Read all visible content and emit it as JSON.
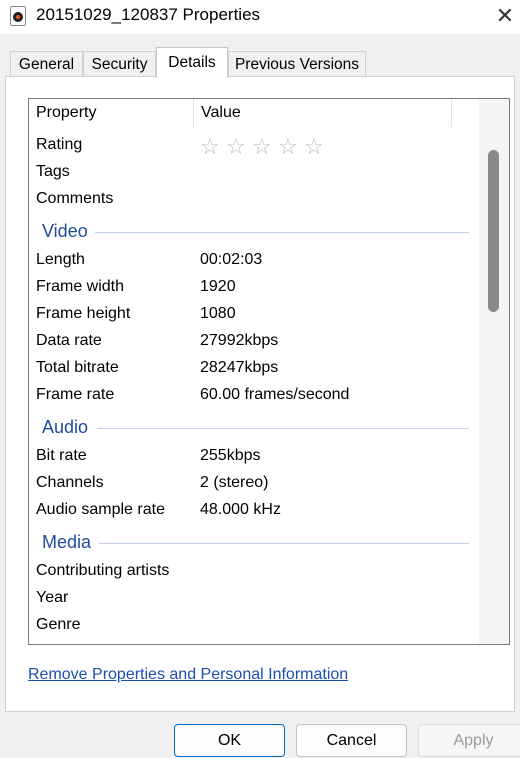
{
  "window": {
    "title": "20151029_120837 Properties",
    "close_glyph": "✕"
  },
  "tabs": [
    {
      "label": "General"
    },
    {
      "label": "Security"
    },
    {
      "label": "Details"
    },
    {
      "label": "Previous Versions"
    }
  ],
  "active_tab": "Details",
  "columns": {
    "property": "Property",
    "value": "Value"
  },
  "rating": {
    "label": "Rating",
    "stars": 0,
    "max": 5,
    "star_glyph": "☆"
  },
  "description_rows": [
    {
      "property": "Tags",
      "value": ""
    },
    {
      "property": "Comments",
      "value": ""
    }
  ],
  "video": {
    "title": "Video",
    "rows": [
      {
        "property": "Length",
        "value": "00:02:03"
      },
      {
        "property": "Frame width",
        "value": "1920"
      },
      {
        "property": "Frame height",
        "value": "1080"
      },
      {
        "property": "Data rate",
        "value": "27992kbps"
      },
      {
        "property": "Total bitrate",
        "value": "28247kbps"
      },
      {
        "property": "Frame rate",
        "value": "60.00 frames/second"
      }
    ]
  },
  "audio": {
    "title": "Audio",
    "rows": [
      {
        "property": "Bit rate",
        "value": "255kbps"
      },
      {
        "property": "Channels",
        "value": "2 (stereo)"
      },
      {
        "property": "Audio sample rate",
        "value": "48.000 kHz"
      }
    ]
  },
  "media": {
    "title": "Media",
    "rows": [
      {
        "property": "Contributing artists",
        "value": ""
      },
      {
        "property": "Year",
        "value": ""
      },
      {
        "property": "Genre",
        "value": ""
      }
    ]
  },
  "remove_link": "Remove Properties and Personal Information",
  "buttons": {
    "ok": "OK",
    "cancel": "Cancel",
    "apply": "Apply"
  },
  "colors": {
    "group_header": "#1e4b9c",
    "link": "#1a4fb0",
    "ok_border": "#0067c0"
  }
}
